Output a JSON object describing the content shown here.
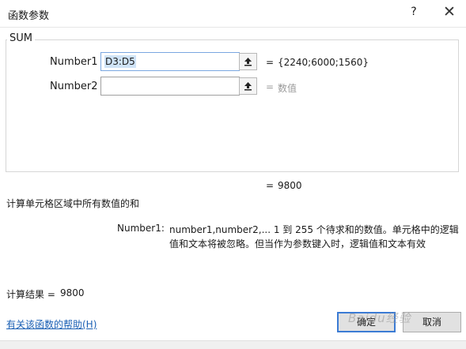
{
  "window": {
    "title": "函数参数",
    "help": "?",
    "close": "✕"
  },
  "function_name": "SUM",
  "args": [
    {
      "label": "Number1",
      "value": "D3:D5",
      "placeholder": "",
      "result": "{2240;6000;1560}"
    },
    {
      "label": "Number2",
      "value": "",
      "placeholder": "",
      "result": "数值"
    }
  ],
  "equals_sign": "=",
  "formula_result": "9800",
  "function_description": "计算单元格区域中所有数值的和",
  "arg_description": {
    "label": "Number1:",
    "text": "number1,number2,... 1 到 255 个待求和的数值。单元格中的逻辑值和文本将被忽略。但当作为参数键入时，逻辑值和文本有效"
  },
  "calc_result": {
    "label": "计算结果 =",
    "value": "9800"
  },
  "help_link": "有关该函数的帮助(H)",
  "buttons": {
    "ok": "确定",
    "cancel": "取消"
  },
  "watermark": "Baidu经验",
  "icons": {
    "collapse": "collapse-dialog-icon",
    "close": "close-icon"
  }
}
